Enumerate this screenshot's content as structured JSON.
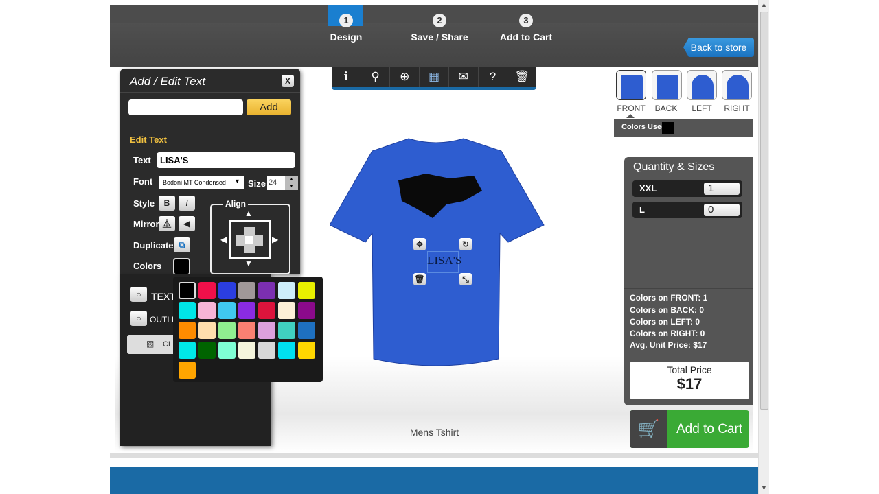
{
  "steps": [
    {
      "num": "1",
      "label": "Design"
    },
    {
      "num": "2",
      "label": "Save / Share"
    },
    {
      "num": "3",
      "label": "Add to Cart"
    }
  ],
  "back_to_store": "Back to store",
  "toolbar": [
    "info-icon",
    "search-icon",
    "zoom-in-icon",
    "save-icon",
    "email-icon",
    "help-icon",
    "trash-icon"
  ],
  "panel": {
    "title": "Add / Edit Text",
    "close": "X",
    "new_text_value": "",
    "add": "Add",
    "edit_heading": "Edit Text",
    "text_label": "Text",
    "text_value": "LISA'S",
    "font_label": "Font",
    "font_value": "Bodoni MT Condensed",
    "size_label": "Size",
    "size_value": "24",
    "style_label": "Style",
    "bold": "B",
    "italic": "I",
    "mirror_label": "Mirror",
    "duplicate_label": "Duplicate",
    "colors_label": "Colors",
    "align_label": "Align",
    "text_shape": "TEXT S",
    "outline": "OUTLIN",
    "clip": "CLI"
  },
  "palette": [
    "#000000",
    "#f0104a",
    "#2b3ee0",
    "#a09898",
    "#7b2fb0",
    "#cdeefa",
    "#e8f000",
    "#00e5e8",
    "#f7b4d6",
    "#40c8f0",
    "#8a2be2",
    "#dc143c",
    "#fdf0d6",
    "#8b0a8b",
    "#ff8c00",
    "#ffdead",
    "#90ee90",
    "#fa8072",
    "#dda0dd",
    "#40d0c0",
    "#1e70c0",
    "#00e8e8",
    "#006400",
    "#7fffd4",
    "#f5f5dc",
    "#d8d8d8",
    "#00e0f0",
    "#ffd700",
    "#ffa500"
  ],
  "design": {
    "text": "LISA'S",
    "product": "Mens Tshirt",
    "shirt_color": "#2e5dd0"
  },
  "views": [
    "FRONT",
    "BACK",
    "LEFT",
    "RIGHT"
  ],
  "colors_used_label": "Colors Used:",
  "colors_used": [
    "#000000"
  ],
  "quantity": {
    "title": "Quantity & Sizes",
    "rows": [
      {
        "size": "XXL",
        "qty": "1"
      },
      {
        "size": "L",
        "qty": "0"
      }
    ]
  },
  "summary": [
    "Colors on FRONT: 1",
    "Colors on BACK: 0",
    "Colors on LEFT: 0",
    "Colors on RIGHT: 0",
    "Avg. Unit Price: $17"
  ],
  "total": {
    "label": "Total Price",
    "value": "$17"
  },
  "add_to_cart": "Add to Cart"
}
